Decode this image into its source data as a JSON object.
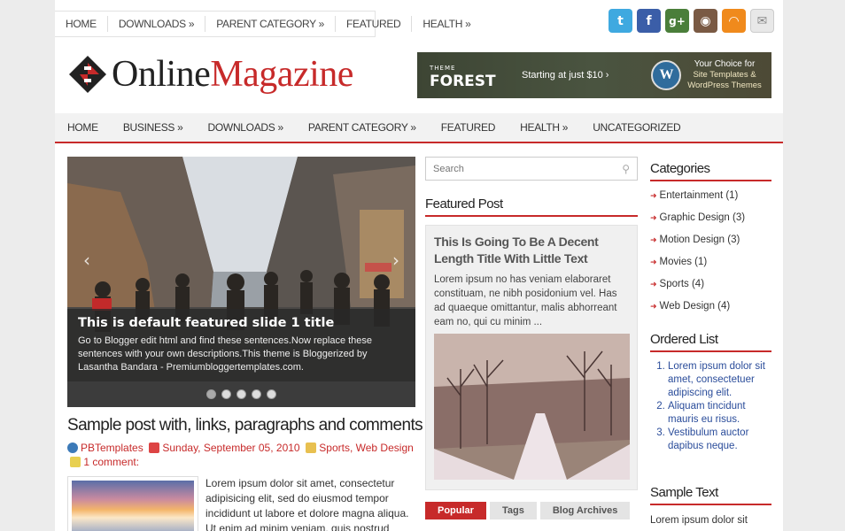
{
  "topnav": [
    "HOME",
    "DOWNLOADS »",
    "PARENT CATEGORY »",
    "FEATURED",
    "HEALTH »"
  ],
  "social": [
    {
      "name": "twitter-icon",
      "glyph": "t",
      "color": "#3fa9e0"
    },
    {
      "name": "facebook-icon",
      "glyph": "f",
      "color": "#3b5ea8"
    },
    {
      "name": "googleplus-icon",
      "glyph": "g+",
      "color": "#4a7e3a"
    },
    {
      "name": "instagram-icon",
      "glyph": "◉",
      "color": "#7a5a44"
    },
    {
      "name": "rss-icon",
      "glyph": "◠",
      "color": "#f08a1c"
    },
    {
      "name": "email-icon",
      "glyph": "✉",
      "color": "#d8d8d8"
    }
  ],
  "logo": {
    "part1": "Online",
    "part2": "Magazine"
  },
  "banner": {
    "brand": "FOREST",
    "brand_small": "THEME",
    "tagline": "Starting at just $10  ›",
    "wp_glyph": "W",
    "choice_title": "Your Choice for",
    "choice_sub": "Site Templates & WordPress Themes"
  },
  "mainnav": [
    "HOME",
    "BUSINESS »",
    "DOWNLOADS »",
    "PARENT CATEGORY »",
    "FEATURED",
    "HEALTH »",
    "UNCATEGORIZED"
  ],
  "slider": {
    "title": "This is default featured slide 1 title",
    "text": "Go to Blogger edit html and find these sentences.Now replace these sentences with your own descriptions.This theme is Bloggerized by Lasantha Bandara - Premiumbloggertemplates.com.",
    "prev": "‹",
    "next": "›",
    "dots": 5
  },
  "post": {
    "title": "Sample post with, links, paragraphs and comments",
    "author": "PBTemplates",
    "date": "Sunday, September 05, 2010",
    "cat1": "Sports",
    "cat2": "Web Design",
    "comments": "1 comment:",
    "excerpt": "Lorem ipsum dolor sit amet, consectetur adipisicing elit, sed do eiusmod tempor incididunt ut labore et dolore magna aliqua. Ut enim ad minim veniam, quis nostrud"
  },
  "search": {
    "placeholder": "Search",
    "icon": "⚲"
  },
  "featured": {
    "heading": "Featured Post",
    "title": "This Is Going To Be A Decent Length Title With Little Text",
    "text": "Lorem ipsum no has veniam elaboraret constituam, ne nibh posidonium vel. Has ad quaeque omittantur, malis abhorreant eam no, qui cu minim ..."
  },
  "tabs": [
    "Popular",
    "Tags",
    "Blog Archives"
  ],
  "categories": {
    "heading": "Categories",
    "items": [
      "Entertainment (1)",
      "Graphic Design (3)",
      "Motion Design (3)",
      "Movies (1)",
      "Sports (4)",
      "Web Design (4)"
    ]
  },
  "ordered": {
    "heading": "Ordered List",
    "items": [
      "Lorem ipsum dolor sit amet, consectetuer adipiscing elit.",
      "Aliquam tincidunt mauris eu risus.",
      "Vestibulum auctor dapibus neque."
    ]
  },
  "sample": {
    "heading": "Sample Text",
    "text": "Lorem ipsum dolor sit"
  }
}
